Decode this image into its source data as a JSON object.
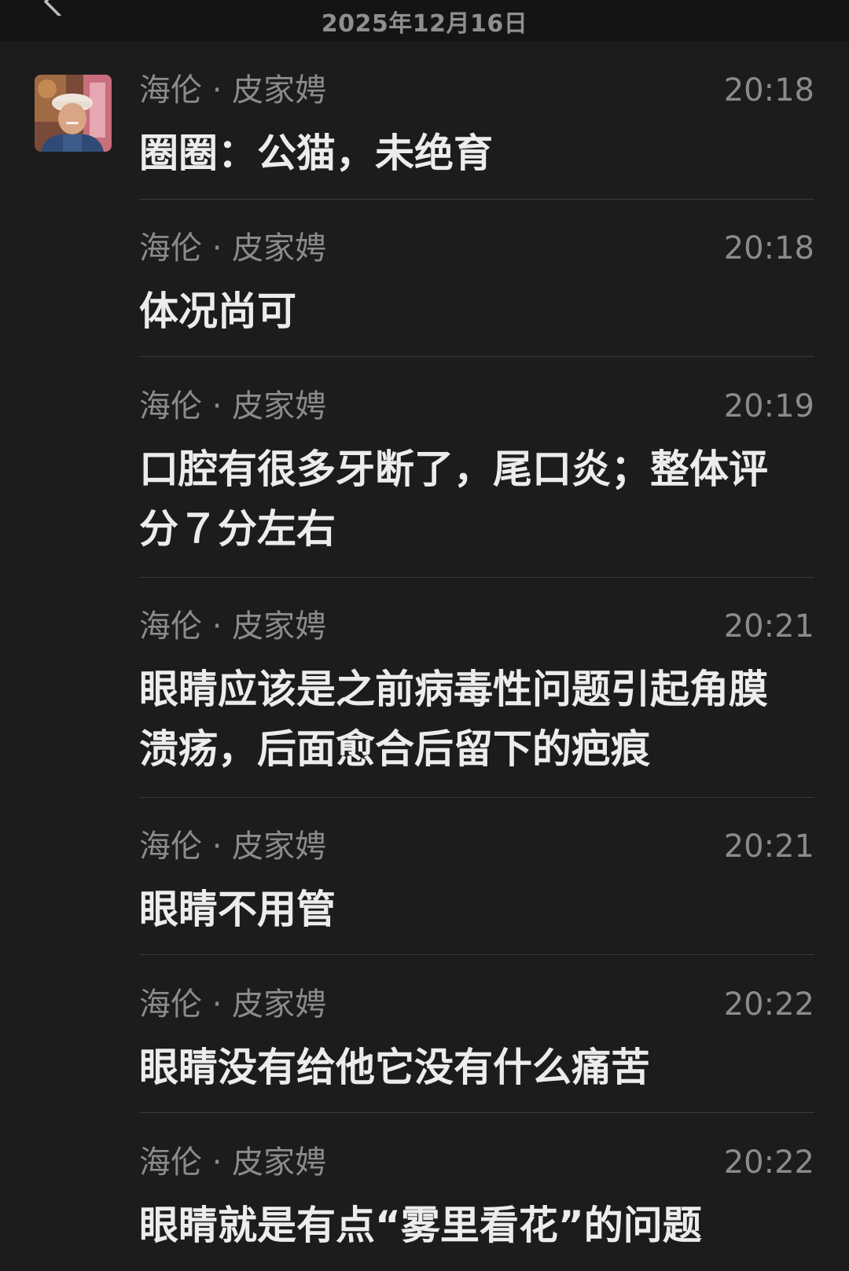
{
  "header": {
    "date": "2025年12月16日",
    "back_icon": "chevron-left-icon"
  },
  "avatar_icon": "user-avatar-photo",
  "messages": [
    {
      "sender": "海伦 · 皮家娉",
      "time": "20:18",
      "text": "圈圈：公猫，未绝育"
    },
    {
      "sender": "海伦 · 皮家娉",
      "time": "20:18",
      "text": "体况尚可"
    },
    {
      "sender": "海伦 · 皮家娉",
      "time": "20:19",
      "text": "口腔有很多牙断了，尾口炎；整体评分７分左右"
    },
    {
      "sender": "海伦 · 皮家娉",
      "time": "20:21",
      "text": "眼睛应该是之前病毒性问题引起角膜溃疡，后面愈合后留下的疤痕"
    },
    {
      "sender": "海伦 · 皮家娉",
      "time": "20:21",
      "text": "眼睛不用管"
    },
    {
      "sender": "海伦 · 皮家娉",
      "time": "20:22",
      "text": "眼睛没有给他它没有什么痛苦"
    },
    {
      "sender": "海伦 · 皮家娉",
      "time": "20:22",
      "text": "眼睛就是有点“雾里看花”的问题"
    }
  ]
}
